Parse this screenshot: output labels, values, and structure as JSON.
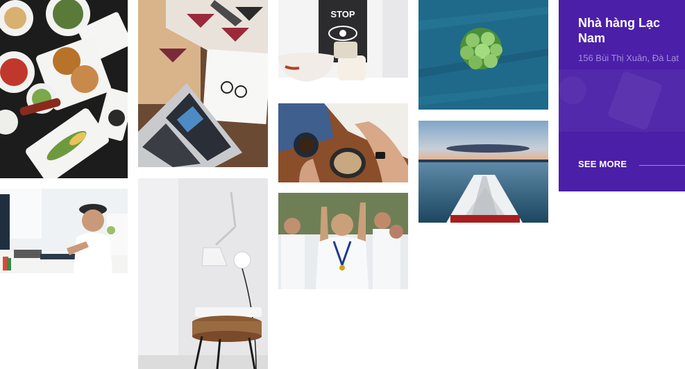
{
  "gallery": {
    "tiles": [
      {
        "id": "food",
        "icon": "food-photo"
      },
      {
        "id": "artist",
        "icon": "artist-photo"
      },
      {
        "id": "desk",
        "icon": "laptop-desk-photo"
      },
      {
        "id": "lamp",
        "icon": "lamp-stool-photo"
      },
      {
        "id": "stop",
        "icon": "stop-sign-photo",
        "sign_text": "STOP"
      },
      {
        "id": "coffee",
        "icon": "coffee-table-photo"
      },
      {
        "id": "football",
        "icon": "football-celebration-photo"
      },
      {
        "id": "pea",
        "icon": "green-peas-photo"
      },
      {
        "id": "kayak",
        "icon": "kayak-lake-photo"
      }
    ]
  },
  "featured": {
    "title": "Nhà hàng Lạc Nam",
    "address": "156 Bùi Thị Xuân, Đà Lạt",
    "cta_label": "SEE MORE",
    "background_color": "#4b1fa8",
    "address_color": "#a58ce0",
    "accent_line_color": "#e07a6a"
  }
}
